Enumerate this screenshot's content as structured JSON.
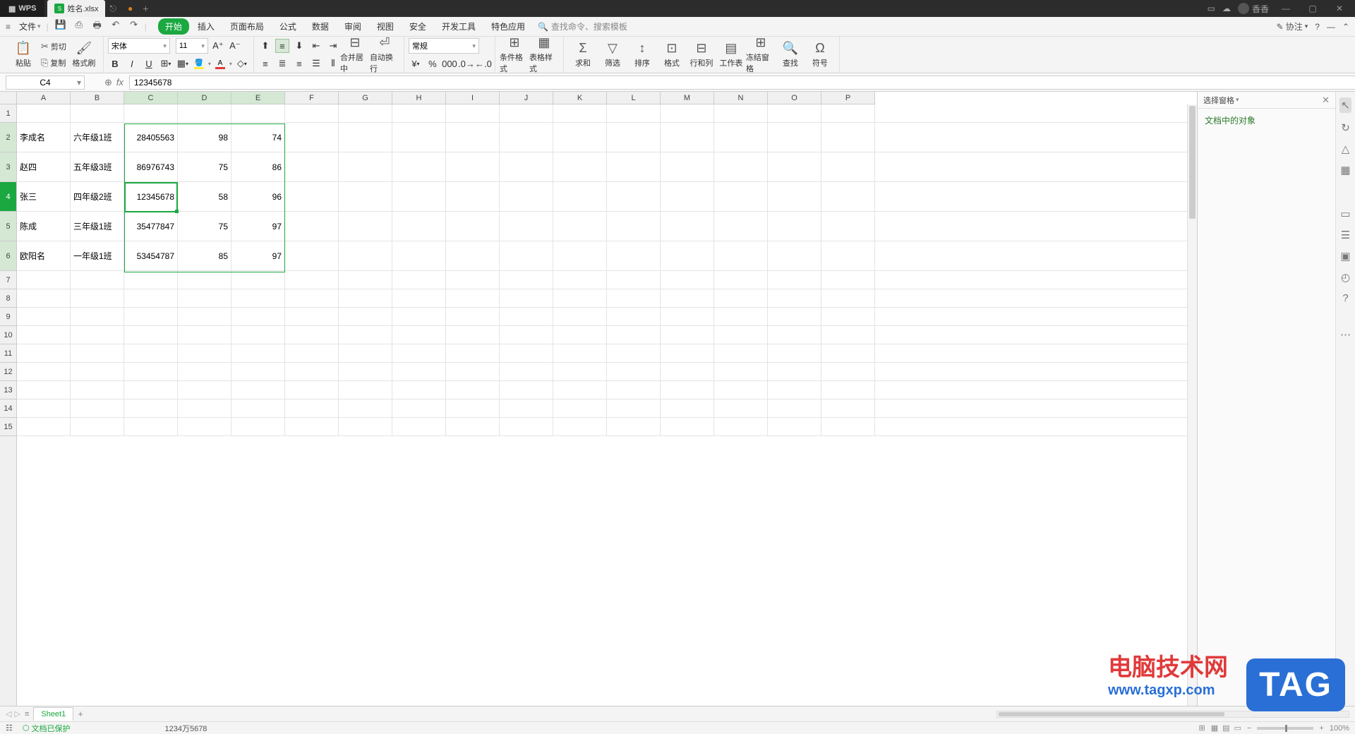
{
  "titlebar": {
    "app": "WPS",
    "tab_filename": "姓名.xlsx",
    "username": "香香"
  },
  "menubar": {
    "file": "文件",
    "tabs": [
      "开始",
      "插入",
      "页面布局",
      "公式",
      "数据",
      "审阅",
      "视图",
      "安全",
      "开发工具",
      "特色应用"
    ],
    "active_tab_index": 0,
    "search_placeholder": "查找命令、搜索模板",
    "collab": "协注"
  },
  "ribbon": {
    "paste": "粘贴",
    "cut": "剪切",
    "copy": "复制",
    "format_painter": "格式刷",
    "font_name": "宋体",
    "font_size": "11",
    "merge": "合并居中",
    "wrap": "自动换行",
    "number_format": "常规",
    "cond_format": "条件格式",
    "table_style": "表格样式",
    "sum": "求和",
    "filter": "筛选",
    "sort": "排序",
    "format": "格式",
    "rowcol": "行和列",
    "worksheet": "工作表",
    "freeze": "冻结窗格",
    "find": "查找",
    "symbol": "符号"
  },
  "fxbar": {
    "cell_ref": "C4",
    "formula": "12345678"
  },
  "grid": {
    "columns": [
      "A",
      "B",
      "C",
      "D",
      "E",
      "F",
      "G",
      "H",
      "I",
      "J",
      "K",
      "L",
      "M",
      "N",
      "O",
      "P"
    ],
    "active_col": "C",
    "active_row": 4,
    "sel_cols": [
      "C",
      "D",
      "E"
    ],
    "sel_rows": [
      2,
      3,
      4,
      5,
      6
    ],
    "row_count": 15,
    "data": [
      {
        "r": 2,
        "A": "李成名",
        "B": "六年级1班",
        "C": "28405563",
        "D": "98",
        "E": "74"
      },
      {
        "r": 3,
        "A": "赵四",
        "B": "五年级3班",
        "C": "86976743",
        "D": "75",
        "E": "86"
      },
      {
        "r": 4,
        "A": "张三",
        "B": "四年级2班",
        "C": "12345678",
        "D": "58",
        "E": "96"
      },
      {
        "r": 5,
        "A": "陈成",
        "B": "三年级1班",
        "C": "35477847",
        "D": "75",
        "E": "97"
      },
      {
        "r": 6,
        "A": "欧阳名",
        "B": "一年级1班",
        "C": "53454787",
        "D": "85",
        "E": "97"
      }
    ]
  },
  "right_panel": {
    "title": "选择窗格",
    "section": "文档中的对象"
  },
  "sheet_tabs": {
    "active": "Sheet1"
  },
  "statusbar": {
    "protect": "文档已保护",
    "value_display": "1234万5678",
    "zoom": "100%"
  },
  "watermark": {
    "line1": "电脑技术网",
    "line2": "www.tagxp.com",
    "badge": "TAG"
  }
}
